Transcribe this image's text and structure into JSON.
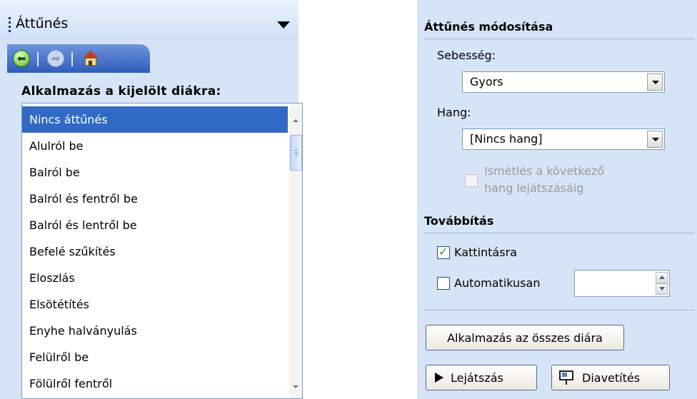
{
  "left_pane": {
    "title": "Áttűnés",
    "nav": {
      "back_icon": "back-icon",
      "forward_icon": "forward-icon",
      "home_icon": "home-icon"
    },
    "apply_heading": "Alkalmazás a kijelölt diákra:",
    "transitions": [
      "Nincs áttűnés",
      "Alulról be",
      "Balról be",
      "Balról és fentről be",
      "Balról és lentről be",
      "Befelé szűkítés",
      "Eloszlás",
      "Elsötétítés",
      "Enyhe halványulás",
      "Felülről be",
      "Fölülről fentről"
    ],
    "selected_index": 0
  },
  "right_pane": {
    "modify_title": "Áttűnés módosítása",
    "speed_label": "Sebesség:",
    "speed_value": "Gyors",
    "sound_label": "Hang:",
    "sound_value": "[Nincs hang]",
    "loop_line1": "Ismétlés a következő",
    "loop_line2": "hang lejátszásáig",
    "advance_title": "Továbbítás",
    "on_click_label": "Kattintásra",
    "on_click_checked": true,
    "auto_label": "Automatikusan",
    "auto_checked": false,
    "auto_value": "",
    "apply_all_button": "Alkalmazás az összes diára",
    "play_button": "Lejátszás",
    "slideshow_button": "Diavetítés"
  },
  "colors": {
    "pane_bg": "#d6e4f8",
    "selection": "#316ac5",
    "nav_bar": "#3d67c2"
  }
}
